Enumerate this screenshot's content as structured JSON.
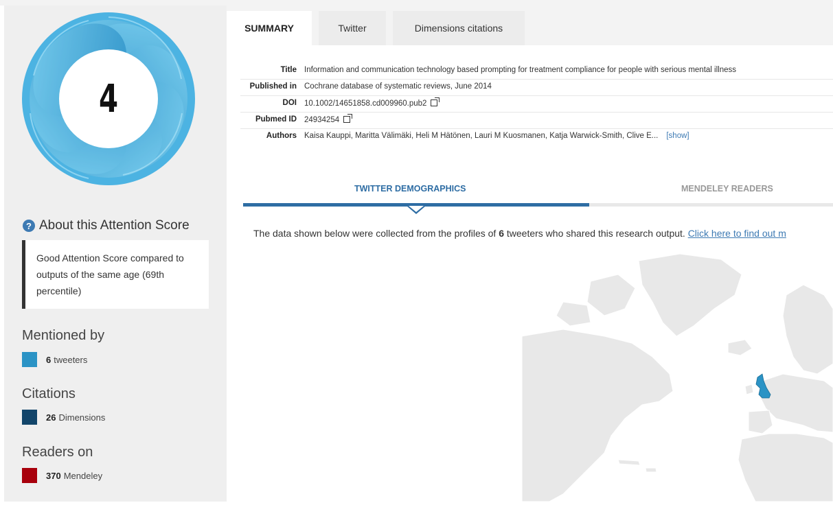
{
  "score": {
    "value": "4"
  },
  "about": {
    "title": "About this Attention Score",
    "text": "Good Attention Score compared to outputs of the same age (69th percentile)"
  },
  "mentioned": {
    "heading": "Mentioned by",
    "count": "6",
    "label": "tweeters",
    "color": "#2b93c5"
  },
  "citations": {
    "heading": "Citations",
    "count": "26",
    "label": "Dimensions",
    "color": "#12456a"
  },
  "readers": {
    "heading": "Readers on",
    "count": "370",
    "label": "Mendeley",
    "color": "#a8000c"
  },
  "tabs": [
    {
      "label": "SUMMARY",
      "active": true
    },
    {
      "label": "Twitter",
      "active": false
    },
    {
      "label": "Dimensions citations",
      "active": false
    }
  ],
  "summary": {
    "title_label": "Title",
    "title_value": "Information and communication technology based prompting for treatment compliance for people with serious mental illness",
    "published_label": "Published in",
    "published_value": "Cochrane database of systematic reviews, June 2014",
    "doi_label": "DOI",
    "doi_value": "10.1002/14651858.cd009960.pub2",
    "pubmed_label": "Pubmed ID",
    "pubmed_value": "24934254",
    "authors_label": "Authors",
    "authors_value": "Kaisa Kauppi, Maritta Välimäki, Heli M Hätönen, Lauri M Kuosmanen, Katja Warwick-Smith, Clive E...",
    "show_label": "[show]"
  },
  "demographics": {
    "tab_twitter": "TWITTER DEMOGRAPHICS",
    "tab_mendeley": "MENDELEY READERS",
    "line_prefix": "The data shown below were collected from the profiles of ",
    "line_count": "6",
    "line_suffix": " tweeters who shared this research output. ",
    "link_text": "Click here to find out m"
  },
  "map": {
    "highlight_color": "#2b93c5",
    "land_color": "#e8e8e8"
  }
}
